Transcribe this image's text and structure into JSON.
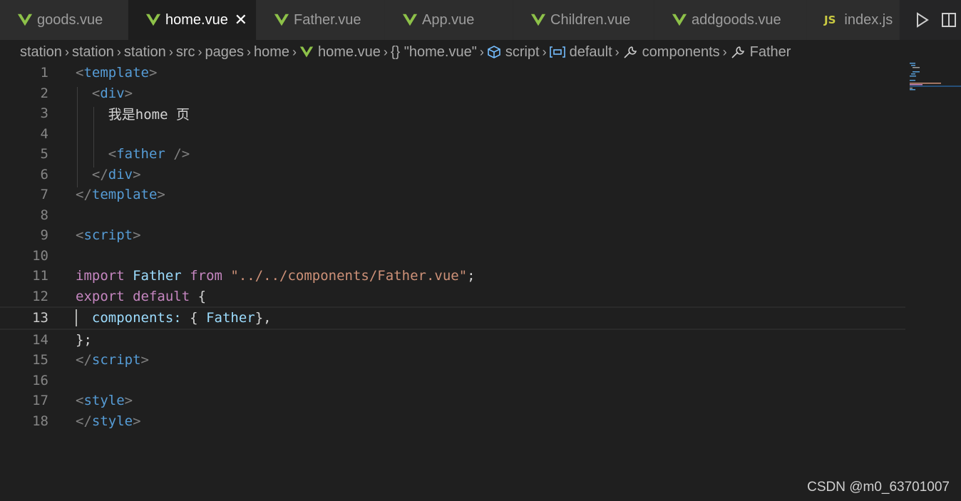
{
  "tabs": [
    {
      "label": "goods.vue",
      "icon": "vue-icon",
      "active": false
    },
    {
      "label": "home.vue",
      "icon": "vue-icon",
      "active": true
    },
    {
      "label": "Father.vue",
      "icon": "vue-icon",
      "active": false
    },
    {
      "label": "App.vue",
      "icon": "vue-icon",
      "active": false
    },
    {
      "label": "Children.vue",
      "icon": "vue-icon",
      "active": false
    },
    {
      "label": "addgoods.vue",
      "icon": "vue-icon",
      "active": false
    },
    {
      "label": "index.js",
      "icon": "js-icon",
      "icon_text": "JS",
      "active": false
    }
  ],
  "breadcrumb": [
    "station",
    "station",
    "station",
    "src",
    "pages",
    "home",
    "home.vue",
    "{} \"home.vue\"",
    "script",
    "default",
    "components",
    "Father"
  ],
  "code_lines": [
    {
      "n": "1"
    },
    {
      "n": "2"
    },
    {
      "n": "3",
      "text_zh": "我是",
      "text_en": "home",
      "text_zh2": "页"
    },
    {
      "n": "4"
    },
    {
      "n": "5"
    },
    {
      "n": "6"
    },
    {
      "n": "7"
    },
    {
      "n": "8"
    },
    {
      "n": "9"
    },
    {
      "n": "10"
    },
    {
      "n": "11",
      "import_kw": "import",
      "ident": "Father",
      "from_kw": "from",
      "path": "\"../../components/Father.vue\""
    },
    {
      "n": "12",
      "export_kw": "export",
      "default_kw": "default"
    },
    {
      "n": "13",
      "prop": "components",
      "ident": "Father"
    },
    {
      "n": "14"
    },
    {
      "n": "15"
    },
    {
      "n": "16"
    },
    {
      "n": "17"
    },
    {
      "n": "18"
    }
  ],
  "tags": {
    "template": "template",
    "div": "div",
    "father": "father",
    "script": "script",
    "style": "style"
  },
  "watermark": "CSDN @m0_63701007",
  "colors": {
    "vue": "#8dc149",
    "js": "#cbcb41",
    "tag": "#569cd6",
    "keyword": "#c586c0",
    "string": "#ce9178",
    "identifier": "#9cdcfe"
  }
}
